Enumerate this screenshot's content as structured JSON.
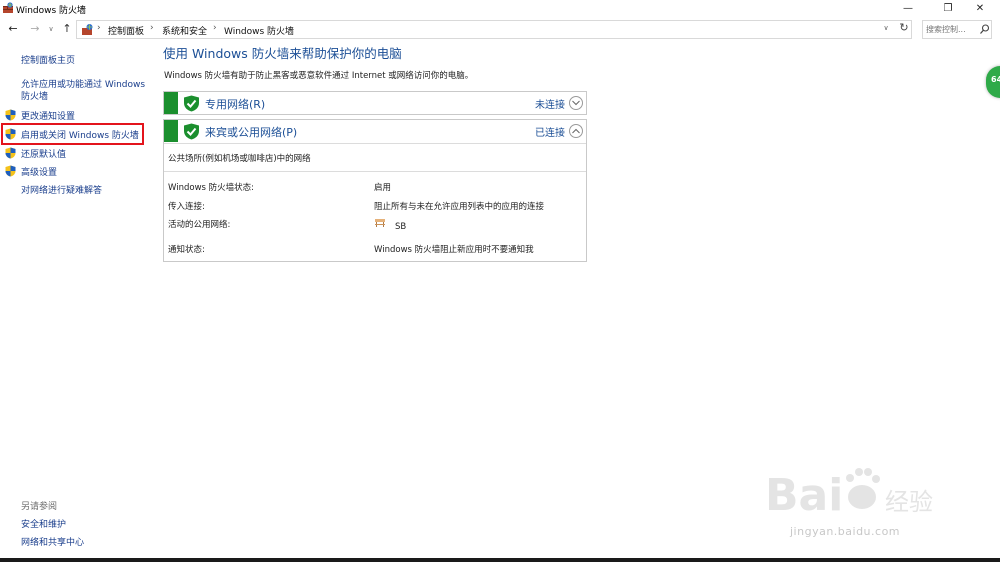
{
  "window": {
    "title": "Windows 防火墙",
    "minimize_glyph": "—",
    "maximize_glyph": "❐",
    "close_glyph": "✕"
  },
  "nav": {
    "back_glyph": "←",
    "forward_glyph": "→",
    "dropdown_glyph": "∨",
    "up_glyph": "↑",
    "refresh_glyph": "↻",
    "breadcrumbs": [
      "控制面板",
      "系统和安全",
      "Windows 防火墙"
    ],
    "crumb_separator": "›",
    "search_placeholder": "搜索控制..."
  },
  "sidebar": {
    "home": "控制面板主页",
    "items": [
      {
        "label": "允许应用或功能通过 Windows 防火墙",
        "icon": "none"
      },
      {
        "label": "更改通知设置",
        "icon": "uac-shield-icon"
      },
      {
        "label": "启用或关闭 Windows 防火墙",
        "icon": "uac-shield-icon",
        "highlighted": true
      },
      {
        "label": "还原默认值",
        "icon": "uac-shield-icon"
      },
      {
        "label": "高级设置",
        "icon": "uac-shield-icon"
      },
      {
        "label": "对网络进行疑难解答",
        "icon": "none"
      }
    ],
    "see_also_title": "另请参阅",
    "see_also": [
      "安全和维护",
      "网络和共享中心"
    ]
  },
  "main": {
    "heading": "使用 Windows 防火墙来帮助保护你的电脑",
    "description": "Windows 防火墙有助于防止黑客或恶意软件通过 Internet 或网络访问你的电脑。",
    "private_network": {
      "title": "专用网络(R)",
      "status": "未连接",
      "expanded": false
    },
    "public_network": {
      "title": "来宾或公用网络(P)",
      "status": "已连接",
      "expanded": true,
      "subtitle": "公共场所(例如机场或咖啡店)中的网络",
      "rows": [
        {
          "label": "Windows 防火墙状态:",
          "value": "启用"
        },
        {
          "label": "传入连接:",
          "value": "阻止所有与未在允许应用列表中的应用的连接"
        },
        {
          "label": "活动的公用网络:",
          "value": "SB"
        },
        {
          "label": "通知状态:",
          "value": "Windows 防火墙阻止新应用时不要通知我"
        }
      ]
    }
  },
  "edge_badge_text": "64",
  "watermark_text": "jingyan.baidu.com",
  "colors": {
    "accent_blue": "#1c4f96",
    "link_blue": "#1a3e8c",
    "firewall_green": "#1b8f2e",
    "highlight_red": "#e3141c"
  }
}
